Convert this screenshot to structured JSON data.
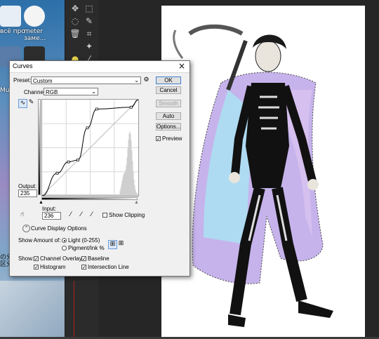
{
  "desktop": {
    "items": [
      {
        "label": "всё про"
      },
      {
        "label": "meter"
      },
      {
        "label": "заме..."
      },
      {
        "label": "Musi"
      }
    ],
    "side_text": [
      "の分",
      "区分"
    ]
  },
  "curves": {
    "title": "Curves",
    "preset_label": "Preset:",
    "preset_value": "Custom",
    "channel_label": "Channel:",
    "channel_value": "RGB",
    "output_label": "Output:",
    "output_value": "235",
    "input_label": "Input:",
    "input_value": "236",
    "show_clipping": "Show Clipping",
    "curve_display_options": "Curve Display Options",
    "show_amount_label": "Show Amount of:",
    "light": "Light  (0-255)",
    "pigment": "Pigment/Ink %",
    "show_label": "Show:",
    "channel_overlays": "Channel Overlays",
    "baseline": "Baseline",
    "histogram": "Histogram",
    "intersection_line": "Intersection Line",
    "buttons": {
      "ok": "OK",
      "cancel": "Cancel",
      "smooth": "Smooth",
      "auto": "Auto",
      "options": "Options..."
    },
    "preview": "Preview",
    "curve_points": [
      [
        0,
        0
      ],
      [
        40,
        60
      ],
      [
        70,
        90
      ],
      [
        95,
        95
      ],
      [
        120,
        180
      ],
      [
        145,
        230
      ],
      [
        236,
        235
      ],
      [
        255,
        255
      ]
    ]
  }
}
